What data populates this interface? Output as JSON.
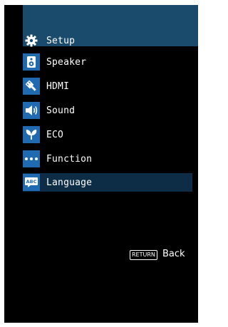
{
  "colors": {
    "screen_background": "#000000",
    "header_band": "#1a4a6c",
    "icon_tile": "#1f6ab0",
    "selected_row": "#0d2c45",
    "text": "#ffffff"
  },
  "menu": {
    "title": {
      "label": "Setup",
      "icon": "gear-icon"
    },
    "items": [
      {
        "label": "Speaker",
        "icon": "speaker-icon"
      },
      {
        "label": "HDMI",
        "icon": "hdmi-plug-icon"
      },
      {
        "label": "Sound",
        "icon": "volume-icon"
      },
      {
        "label": "ECO",
        "icon": "leaf-icon"
      },
      {
        "label": "Function",
        "icon": "dots-icon"
      },
      {
        "label": "Language",
        "icon": "abc-icon",
        "selected": true
      }
    ],
    "more_indicator": "›"
  },
  "footer": {
    "return_key_label": "RETURN",
    "back_label": "Back"
  }
}
